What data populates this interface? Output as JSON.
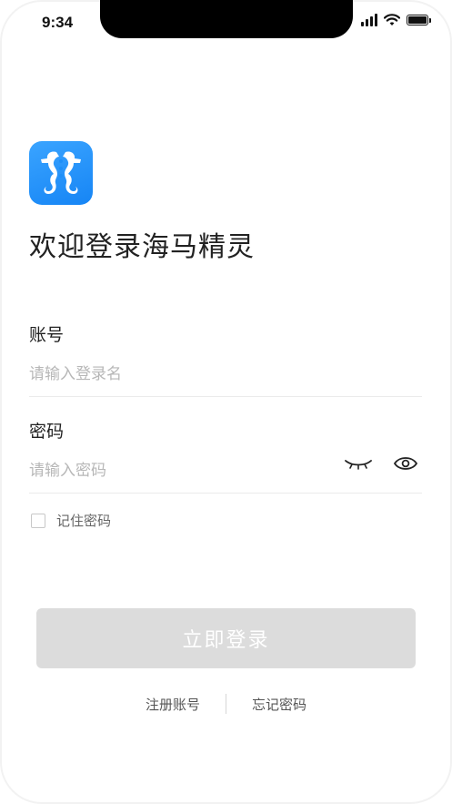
{
  "status_bar": {
    "time": "9:34",
    "signal_icon": "signal-icon",
    "wifi_icon": "wifi-icon",
    "battery_icon": "battery-icon"
  },
  "app": {
    "logo_icon": "seahorse-logo-icon",
    "brand_color": "#1e8ff8"
  },
  "header": {
    "title": "欢迎登录海马精灵"
  },
  "form": {
    "account_label": "账号",
    "account_placeholder": "请输入登录名",
    "password_label": "密码",
    "password_placeholder": "请输入密码",
    "hide_password_icon": "eye-closed-icon",
    "show_password_icon": "eye-open-icon",
    "remember_label": "记住密码"
  },
  "actions": {
    "login_label": "立即登录",
    "login_disabled_color": "#dcdcdc"
  },
  "footer": {
    "register_label": "注册账号",
    "forgot_label": "忘记密码"
  }
}
